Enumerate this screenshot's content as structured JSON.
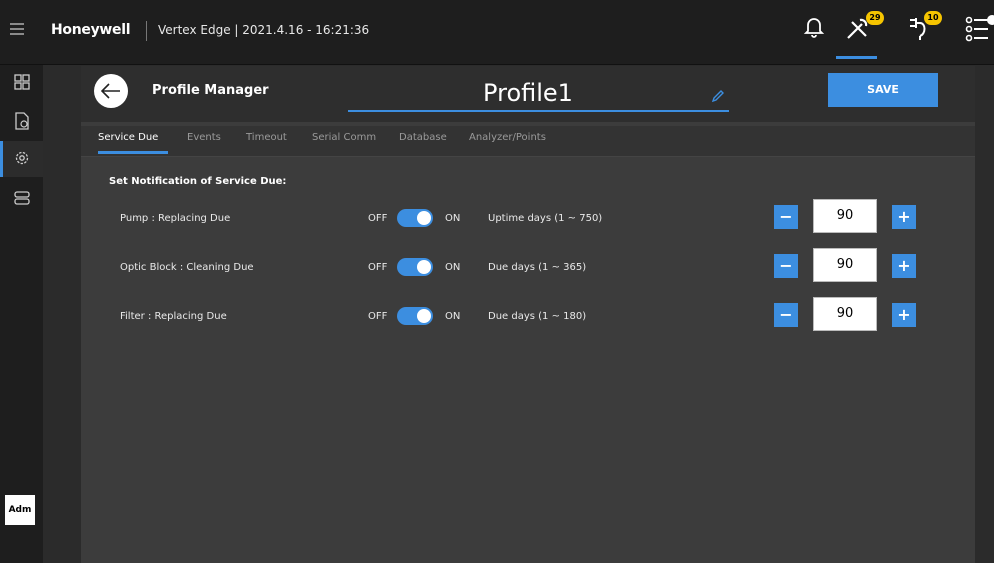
{
  "header": {
    "brand": "Honeywell",
    "title": "Vertex Edge | 2021.4.16 - 16:21:36",
    "tools_badge": "29",
    "plugin_badge": "10"
  },
  "sidebar": {
    "avatar": "Adm"
  },
  "page": {
    "title": "Profile Manager",
    "profile_name": "Profile1",
    "save_label": "SAVE"
  },
  "tabs": [
    "Service Due",
    "Events",
    "Timeout",
    "Serial Comm",
    "Database",
    "Analyzer/Points"
  ],
  "section_title": "Set Notification of Service Due:",
  "rows": [
    {
      "label": "Pump : Replacing Due",
      "off": "OFF",
      "on": "ON",
      "range": "Uptime days (1 ~ 750)",
      "value": "90",
      "minus": "−",
      "plus": "+"
    },
    {
      "label": "Optic Block : Cleaning Due",
      "off": "OFF",
      "on": "ON",
      "range": "Due days (1 ~ 365)",
      "value": "90",
      "minus": "−",
      "plus": "+"
    },
    {
      "label": "Filter : Replacing Due",
      "off": "OFF",
      "on": "ON",
      "range": "Due days (1 ~ 180)",
      "value": "90",
      "minus": "−",
      "plus": "+"
    }
  ],
  "colors": {
    "accent": "#3c8ee0",
    "badge": "#f5c400"
  }
}
